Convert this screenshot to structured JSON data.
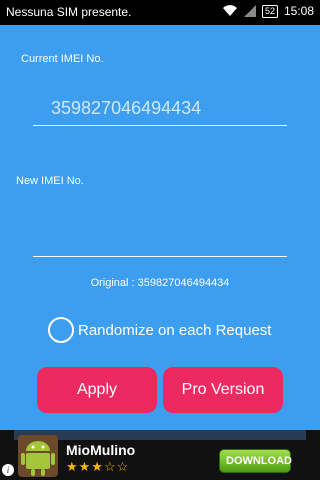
{
  "status_bar": {
    "carrier": "Nessuna SIM presente.",
    "battery": "52",
    "time": "15:08"
  },
  "form": {
    "current_label": "Current IMEI No.",
    "current_value": "359827046494434",
    "new_label": "New IMEI No.",
    "new_value": "",
    "original_text": "Original : 359827046494434",
    "randomize_label": "Randomize on each Request",
    "randomize_checked": false,
    "apply_label": "Apply",
    "pro_label": "Pro Version"
  },
  "ad": {
    "app_name": "MioMulino",
    "rating_stars": "★★★☆☆",
    "rating": 3,
    "download_label": "DOWNLOAD",
    "info_glyph": "i"
  },
  "colors": {
    "background": "#3d9ef0",
    "button": "#ec2a61",
    "status_bar": "#000000",
    "download_button": "#7ac231"
  },
  "icons": [
    "wifi-icon",
    "signal-icon",
    "battery-icon",
    "radio-unchecked-icon",
    "android-robot-icon",
    "info-icon"
  ]
}
